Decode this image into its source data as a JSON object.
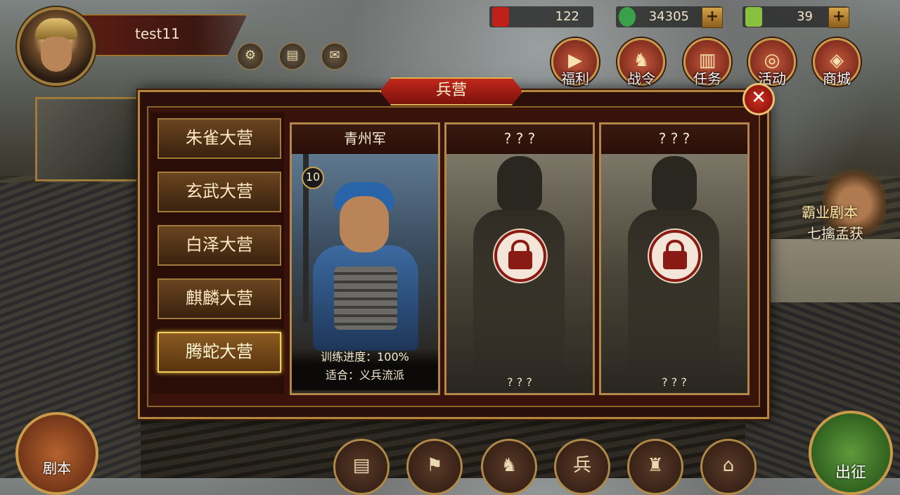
{
  "player": {
    "name": "test11"
  },
  "currencies": [
    {
      "name": "red-envelope",
      "value": "122",
      "color": "#c0201a"
    },
    {
      "name": "jade",
      "value": "34305",
      "color": "#3aa04a"
    },
    {
      "name": "bamboo-token",
      "value": "39",
      "color": "#8ac040"
    }
  ],
  "top_menu": [
    {
      "label": "福利",
      "icon": "video-icon"
    },
    {
      "label": "战令",
      "icon": "warhorn-icon"
    },
    {
      "label": "任务",
      "icon": "scroll-icon"
    },
    {
      "label": "活动",
      "icon": "drum-icon"
    },
    {
      "label": "商城",
      "icon": "coin-icon"
    }
  ],
  "promo": {
    "line1": "霸业剧本",
    "line2": "七擒孟获"
  },
  "modal": {
    "title": "兵营",
    "close": "✕",
    "tabs": [
      {
        "label": "朱雀大营",
        "active": false
      },
      {
        "label": "玄武大营",
        "active": false
      },
      {
        "label": "白泽大营",
        "active": false
      },
      {
        "label": "麒麟大营",
        "active": false
      },
      {
        "label": "腾蛇大营",
        "active": true
      }
    ],
    "cards": [
      {
        "name": "青州军",
        "level": "10",
        "progress_label": "训练进度：100%",
        "fit_label": "适合：义兵流派",
        "locked": false
      },
      {
        "name": "? ? ?",
        "footer": "? ? ?",
        "locked": true
      },
      {
        "name": "? ? ?",
        "footer": "? ? ?",
        "locked": true
      }
    ]
  },
  "bottom": {
    "left_label": "剧本",
    "right_label": "出征"
  }
}
